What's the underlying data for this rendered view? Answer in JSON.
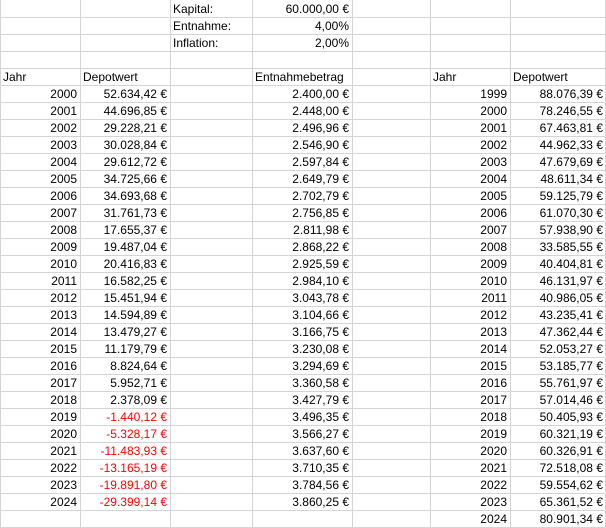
{
  "params": {
    "kapital_label": "Kapital:",
    "kapital_value": "60.000,00 €",
    "entnahme_label": "Entnahme:",
    "entnahme_value": "4,00%",
    "inflation_label": "Inflation:",
    "inflation_value": "2,00%"
  },
  "headers": {
    "jahr": "Jahr",
    "depotwert": "Depotwert",
    "entnahmebetrag": "Entnahmebetrag",
    "jahr2": "Jahr",
    "depotwert2": "Depotwert"
  },
  "table_left": [
    {
      "jahr": "2000",
      "depotwert": "52.634,42 €",
      "entnahme": "2.400,00 €",
      "negative": false
    },
    {
      "jahr": "2001",
      "depotwert": "44.696,85 €",
      "entnahme": "2.448,00 €",
      "negative": false
    },
    {
      "jahr": "2002",
      "depotwert": "29.228,21 €",
      "entnahme": "2.496,96 €",
      "negative": false
    },
    {
      "jahr": "2003",
      "depotwert": "30.028,84 €",
      "entnahme": "2.546,90 €",
      "negative": false
    },
    {
      "jahr": "2004",
      "depotwert": "29.612,72 €",
      "entnahme": "2.597,84 €",
      "negative": false
    },
    {
      "jahr": "2005",
      "depotwert": "34.725,66 €",
      "entnahme": "2.649,79 €",
      "negative": false
    },
    {
      "jahr": "2006",
      "depotwert": "34.693,68 €",
      "entnahme": "2.702,79 €",
      "negative": false
    },
    {
      "jahr": "2007",
      "depotwert": "31.761,73 €",
      "entnahme": "2.756,85 €",
      "negative": false
    },
    {
      "jahr": "2008",
      "depotwert": "17.655,37 €",
      "entnahme": "2.811,98 €",
      "negative": false
    },
    {
      "jahr": "2009",
      "depotwert": "19.487,04 €",
      "entnahme": "2.868,22 €",
      "negative": false
    },
    {
      "jahr": "2010",
      "depotwert": "20.416,83 €",
      "entnahme": "2.925,59 €",
      "negative": false
    },
    {
      "jahr": "2011",
      "depotwert": "16.582,25 €",
      "entnahme": "2.984,10 €",
      "negative": false
    },
    {
      "jahr": "2012",
      "depotwert": "15.451,94 €",
      "entnahme": "3.043,78 €",
      "negative": false
    },
    {
      "jahr": "2013",
      "depotwert": "14.594,89 €",
      "entnahme": "3.104,66 €",
      "negative": false
    },
    {
      "jahr": "2014",
      "depotwert": "13.479,27 €",
      "entnahme": "3.166,75 €",
      "negative": false
    },
    {
      "jahr": "2015",
      "depotwert": "11.179,79 €",
      "entnahme": "3.230,08 €",
      "negative": false
    },
    {
      "jahr": "2016",
      "depotwert": "8.824,64 €",
      "entnahme": "3.294,69 €",
      "negative": false
    },
    {
      "jahr": "2017",
      "depotwert": "5.952,71 €",
      "entnahme": "3.360,58 €",
      "negative": false
    },
    {
      "jahr": "2018",
      "depotwert": "2.378,09 €",
      "entnahme": "3.427,79 €",
      "negative": false
    },
    {
      "jahr": "2019",
      "depotwert": "-1.440,12 €",
      "entnahme": "3.496,35 €",
      "negative": true
    },
    {
      "jahr": "2020",
      "depotwert": "-5.328,17 €",
      "entnahme": "3.566,27 €",
      "negative": true
    },
    {
      "jahr": "2021",
      "depotwert": "-11.483,93 €",
      "entnahme": "3.637,60 €",
      "negative": true
    },
    {
      "jahr": "2022",
      "depotwert": "-13.165,19 €",
      "entnahme": "3.710,35 €",
      "negative": true
    },
    {
      "jahr": "2023",
      "depotwert": "-19.891,80 €",
      "entnahme": "3.784,56 €",
      "negative": true
    },
    {
      "jahr": "2024",
      "depotwert": "-29.399,14 €",
      "entnahme": "3.860,25 €",
      "negative": true
    }
  ],
  "table_right": [
    {
      "jahr": "1999",
      "depotwert": "88.076,39 €"
    },
    {
      "jahr": "2000",
      "depotwert": "78.246,55 €"
    },
    {
      "jahr": "2001",
      "depotwert": "67.463,81 €"
    },
    {
      "jahr": "2002",
      "depotwert": "44.962,33 €"
    },
    {
      "jahr": "2003",
      "depotwert": "47.679,69 €"
    },
    {
      "jahr": "2004",
      "depotwert": "48.611,34 €"
    },
    {
      "jahr": "2005",
      "depotwert": "59.125,79 €"
    },
    {
      "jahr": "2006",
      "depotwert": "61.070,30 €"
    },
    {
      "jahr": "2007",
      "depotwert": "57.938,90 €"
    },
    {
      "jahr": "2008",
      "depotwert": "33.585,55 €"
    },
    {
      "jahr": "2009",
      "depotwert": "40.404,81 €"
    },
    {
      "jahr": "2010",
      "depotwert": "46.131,97 €"
    },
    {
      "jahr": "2011",
      "depotwert": "40.986,05 €"
    },
    {
      "jahr": "2012",
      "depotwert": "43.235,41 €"
    },
    {
      "jahr": "2013",
      "depotwert": "47.362,44 €"
    },
    {
      "jahr": "2014",
      "depotwert": "52.053,27 €"
    },
    {
      "jahr": "2015",
      "depotwert": "53.185,77 €"
    },
    {
      "jahr": "2016",
      "depotwert": "55.761,97 €"
    },
    {
      "jahr": "2017",
      "depotwert": "57.014,46 €"
    },
    {
      "jahr": "2018",
      "depotwert": "50.405,93 €"
    },
    {
      "jahr": "2019",
      "depotwert": "60.321,19 €"
    },
    {
      "jahr": "2020",
      "depotwert": "60.326,91 €"
    },
    {
      "jahr": "2021",
      "depotwert": "72.518,08 €"
    },
    {
      "jahr": "2022",
      "depotwert": "59.554,62 €"
    },
    {
      "jahr": "2023",
      "depotwert": "65.361,52 €"
    },
    {
      "jahr": "2024",
      "depotwert": "80.901,34 €"
    }
  ],
  "colors": {
    "gridline": "#d4d4d4",
    "negative_text": "#ff0000",
    "text": "#000000"
  }
}
